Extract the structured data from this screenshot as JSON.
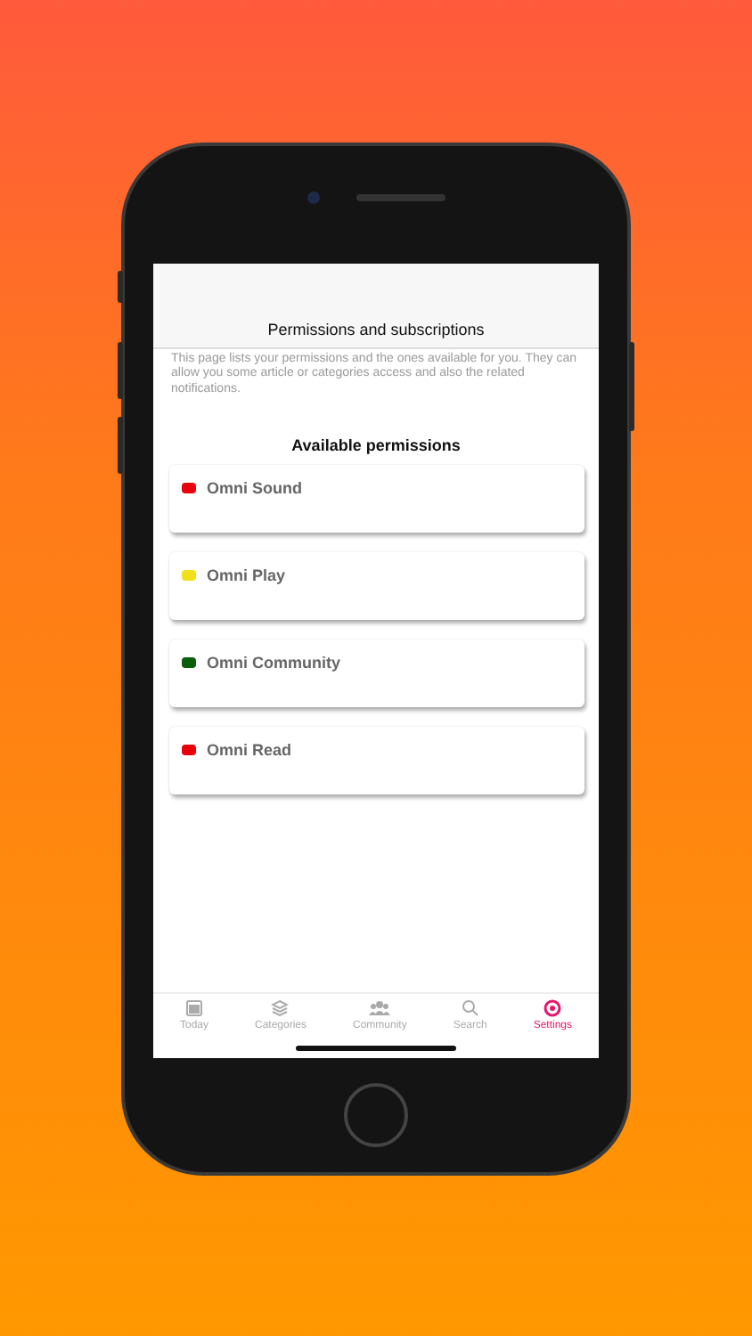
{
  "screen": {
    "title": "Permissions and subscriptions",
    "description": "This page lists your permissions and the ones available for you. They can allow you some article or categories access and also the related notifications.",
    "section_title": "Available permissions",
    "permissions": [
      {
        "name": "Omni Sound",
        "color": "#e8000b"
      },
      {
        "name": "Omni Play",
        "color": "#f2e01c"
      },
      {
        "name": "Omni Community",
        "color": "#0b5e0b"
      },
      {
        "name": "Omni Read",
        "color": "#e8000b"
      }
    ]
  },
  "tab_bar": [
    {
      "label": "Today",
      "kind": "today",
      "selected": false
    },
    {
      "label": "Categories",
      "kind": "categories",
      "selected": false
    },
    {
      "label": "Community",
      "kind": "community",
      "selected": false
    },
    {
      "label": "Search",
      "kind": "search",
      "selected": false
    },
    {
      "label": "Settings",
      "kind": "settings",
      "selected": true
    }
  ]
}
